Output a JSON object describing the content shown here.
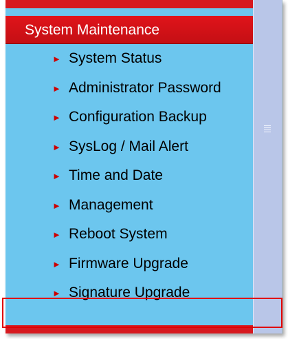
{
  "colors": {
    "panel_background": "#6cc6ee",
    "header_red": "#d7191f",
    "arrow_red": "#cc0000",
    "highlight_border": "#e00000",
    "sidebar_strip": "#b9c6e8"
  },
  "section": {
    "title": "System Maintenance"
  },
  "menu": {
    "items": [
      {
        "label": "System Status",
        "icon": "triangle-right-icon"
      },
      {
        "label": "Administrator Password",
        "icon": "triangle-right-icon"
      },
      {
        "label": "Configuration Backup",
        "icon": "triangle-right-icon"
      },
      {
        "label": "SysLog / Mail Alert",
        "icon": "triangle-right-icon"
      },
      {
        "label": "Time and Date",
        "icon": "triangle-right-icon"
      },
      {
        "label": "Management",
        "icon": "triangle-right-icon"
      },
      {
        "label": "Reboot System",
        "icon": "triangle-right-icon"
      },
      {
        "label": "Firmware Upgrade",
        "icon": "triangle-right-icon"
      },
      {
        "label": "Signature Upgrade",
        "icon": "triangle-right-icon",
        "highlighted": true
      }
    ]
  }
}
